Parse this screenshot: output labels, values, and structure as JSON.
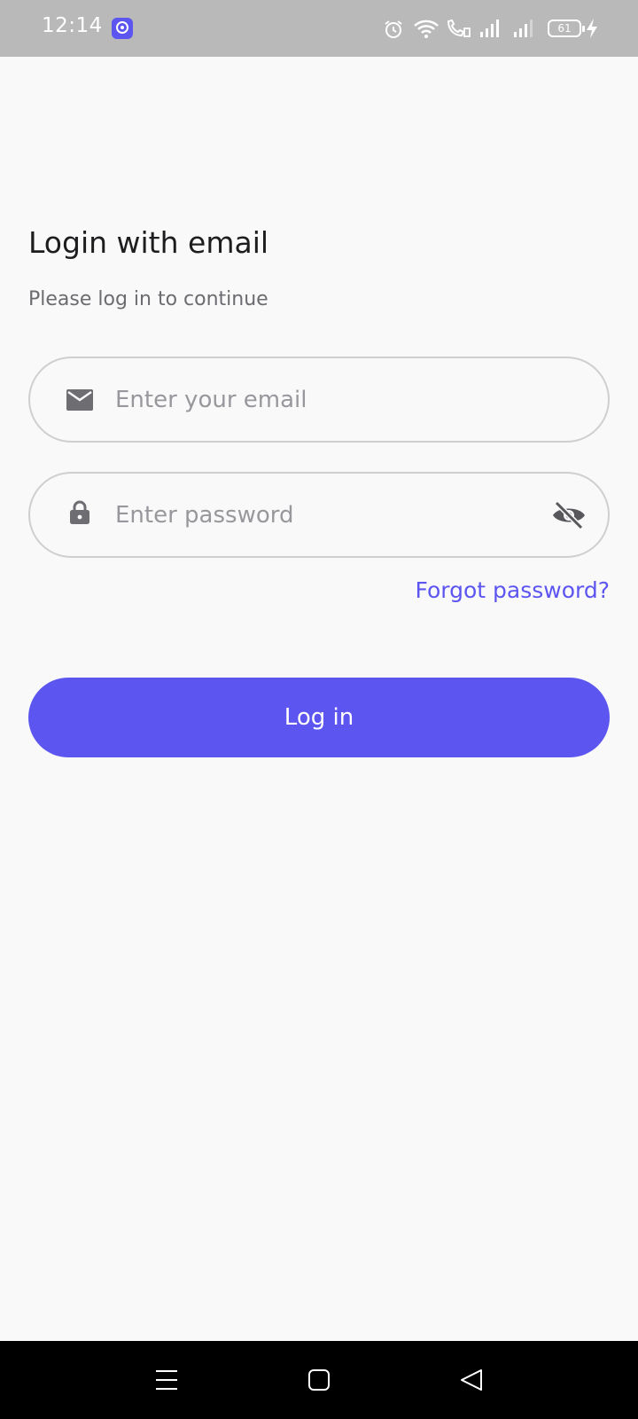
{
  "status_bar": {
    "time": "12:14",
    "battery": "61",
    "icons": [
      "app-notification-icon",
      "alarm-icon",
      "wifi-icon",
      "wifi-calling-icon",
      "signal-1-icon",
      "signal-2-icon",
      "battery-icon",
      "charging-icon"
    ]
  },
  "login": {
    "title": "Login with email",
    "subtitle": "Please log in to continue",
    "email_placeholder": "Enter your email",
    "password_placeholder": "Enter password",
    "forgot_label": "Forgot password?",
    "login_label": "Log in"
  },
  "colors": {
    "accent": "#5c55f0",
    "background": "#f9f9fa",
    "status_bar": "#b9b9b9"
  },
  "nav_bar": {
    "icons": [
      "menu-icon",
      "home-icon",
      "back-icon"
    ]
  }
}
